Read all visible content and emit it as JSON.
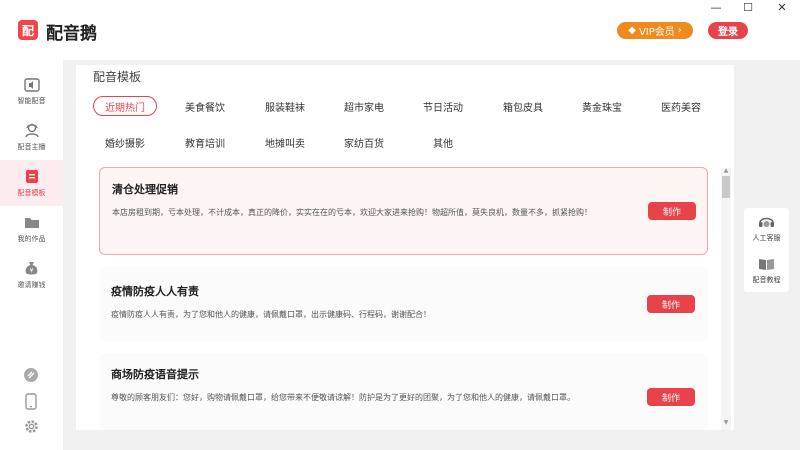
{
  "app": {
    "logo_char": "配",
    "title": "配音鹅",
    "vip_label": "VIP会员",
    "vip_chevron": "›",
    "login_label": "登录",
    "window_controls": [
      "—",
      "☐",
      "✕"
    ]
  },
  "sidebar": {
    "items": [
      {
        "label": "智能配音",
        "icon": "speaker-icon"
      },
      {
        "label": "配音主播",
        "icon": "anchor-icon"
      },
      {
        "label": "配音模板",
        "icon": "template-icon"
      },
      {
        "label": "我的作品",
        "icon": "folder-icon"
      },
      {
        "label": "邀请赚钱",
        "icon": "money-bag-icon"
      }
    ],
    "active_index": 2
  },
  "main": {
    "panel_title": "配音模板",
    "tabs_row1": [
      "近期热门",
      "美食餐饮",
      "服装鞋袜",
      "超市家电",
      "节日活动",
      "箱包皮具",
      "黄金珠宝",
      "医药美容"
    ],
    "tabs_row2": [
      "婚纱摄影",
      "教育培训",
      "地摊叫卖",
      "家纺百货",
      "其他"
    ],
    "active_tab": "近期热门",
    "cards": [
      {
        "title": "清仓处理促销",
        "desc": "本店房租到期，亏本处理，不计成本，真正的降价，实实在在的亏本，欢迎大家进来抢购！物超所值，莫失良机，数量不多，抓紧抢购！",
        "button": "制作"
      },
      {
        "title": "疫情防疫人人有责",
        "desc": "疫情防疫人人有责，为了您和他人的健康，请佩戴口罩，出示健康码、行程码，谢谢配合！",
        "button": "制作"
      },
      {
        "title": "商场防疫语音提示",
        "desc": "尊敬的顾客朋友们：您好，购物请佩戴口罩，给您带来不便敬请谅解！防护是为了更好的团聚，为了您和他人的健康，请佩戴口罩。",
        "button": "制作"
      }
    ]
  },
  "right_helpers": [
    {
      "label": "人工客服",
      "icon": "customer-service-icon"
    },
    {
      "label": "配音教程",
      "icon": "tutorial-book-icon"
    }
  ],
  "colors": {
    "accent": "#e8424a",
    "vip": "#f08a1e",
    "background": "#f0f0f0"
  }
}
